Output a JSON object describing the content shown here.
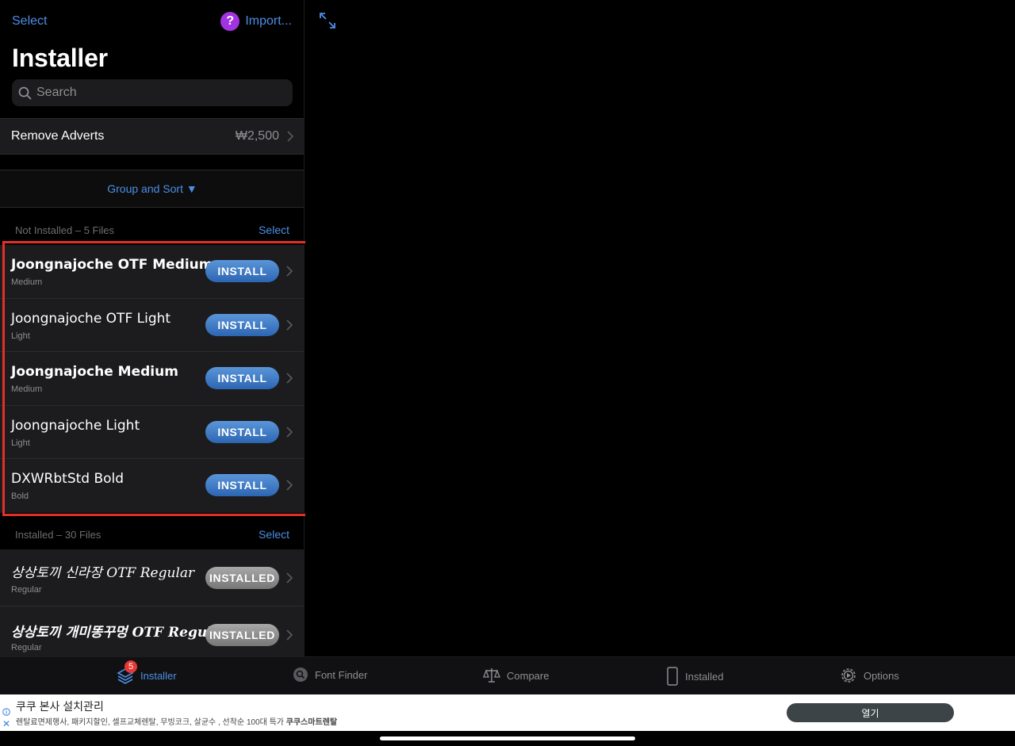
{
  "nav": {
    "select_label": "Select",
    "import_label": "Import...",
    "help_glyph": "?"
  },
  "title": "Installer",
  "search": {
    "placeholder": "Search",
    "value": ""
  },
  "remove_ads": {
    "label": "Remove Adverts",
    "price": "₩2,500"
  },
  "group_sort": {
    "label": "Group and Sort ▼"
  },
  "not_installed": {
    "header": "Not Installed – 5 Files",
    "select_label": "Select",
    "items": [
      {
        "name": "Joongnajoche OTF Medium",
        "style": "Medium",
        "button": "INSTALL"
      },
      {
        "name": "Joongnajoche OTF Light",
        "style": "Light",
        "button": "INSTALL"
      },
      {
        "name": "Joongnajoche Medium",
        "style": "Medium",
        "button": "INSTALL"
      },
      {
        "name": "Joongnajoche Light",
        "style": "Light",
        "button": "INSTALL"
      },
      {
        "name": "DXWRbtStd Bold",
        "style": "Bold",
        "button": "INSTALL"
      }
    ]
  },
  "installed": {
    "header": "Installed – 30 Files",
    "select_label": "Select",
    "items": [
      {
        "name": "상상토끼 신라장 OTF Regular",
        "style": "Regular",
        "button": "INSTALLED"
      },
      {
        "name": "상상토끼 개미똥꾸멍 OTF Regular",
        "style": "Regular",
        "button": "INSTALLED"
      }
    ]
  },
  "tabbar": {
    "tabs": [
      {
        "label": "Installer",
        "icon": "layers-icon",
        "badge": "5",
        "active": true
      },
      {
        "label": "Font Finder",
        "icon": "search-icon"
      },
      {
        "label": "Compare",
        "icon": "scales-icon"
      },
      {
        "label": "Installed",
        "icon": "device-icon"
      },
      {
        "label": "Options",
        "icon": "gear-icon"
      }
    ]
  },
  "ad": {
    "title": "쿠쿠 본사 설치관리",
    "subtitle": "렌탈료면제행사, 패키지할인, 셀프교체렌탈, 무빙코크, 살균수 , 선착순 100대 특가 ",
    "subtitle_bold": "쿠쿠스마트렌탈",
    "open_label": "열기"
  },
  "colors": {
    "accent": "#4d8fe6",
    "install": "#3a78c6",
    "installed": "#8e8e8e",
    "highlight": "#e0302a",
    "help": "#a233e0"
  }
}
